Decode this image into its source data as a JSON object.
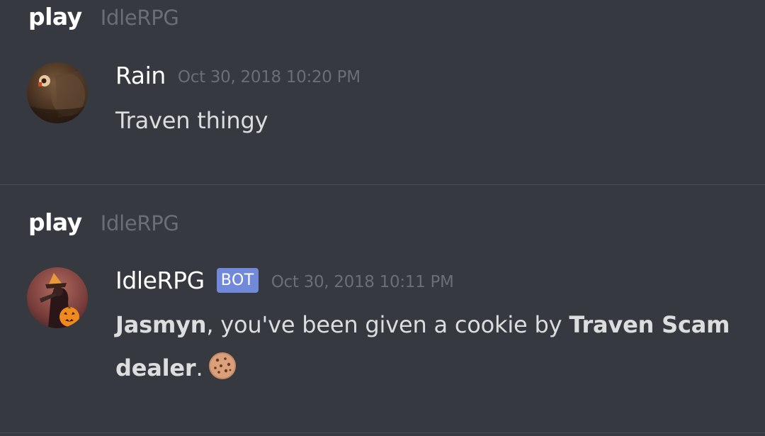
{
  "messages": [
    {
      "channel": "play",
      "guild": "IdleRPG",
      "author": "Rain",
      "is_bot": false,
      "timestamp": "Oct 30, 2018 10:20 PM",
      "text": "Traven thingy",
      "avatar_icon": "rain-avatar"
    },
    {
      "channel": "play",
      "guild": "IdleRPG",
      "author": "IdleRPG",
      "is_bot": true,
      "bot_tag": "BOT",
      "timestamp": "Oct 30, 2018 10:11 PM",
      "text_parts": {
        "recipient": "Jasmyn",
        "middle": ", you've been given a cookie by ",
        "giver_line1": "Traven Scam",
        "giver_line2": "dealer",
        "end": "."
      },
      "emoji": "cookie-icon",
      "avatar_icon": "idlerpg-avatar"
    }
  ],
  "colors": {
    "background": "#36393f",
    "divider": "#4a4d53",
    "muted_text": "#6b6e74",
    "message_text": "#dcddde",
    "bot_tag": "#7289da"
  }
}
